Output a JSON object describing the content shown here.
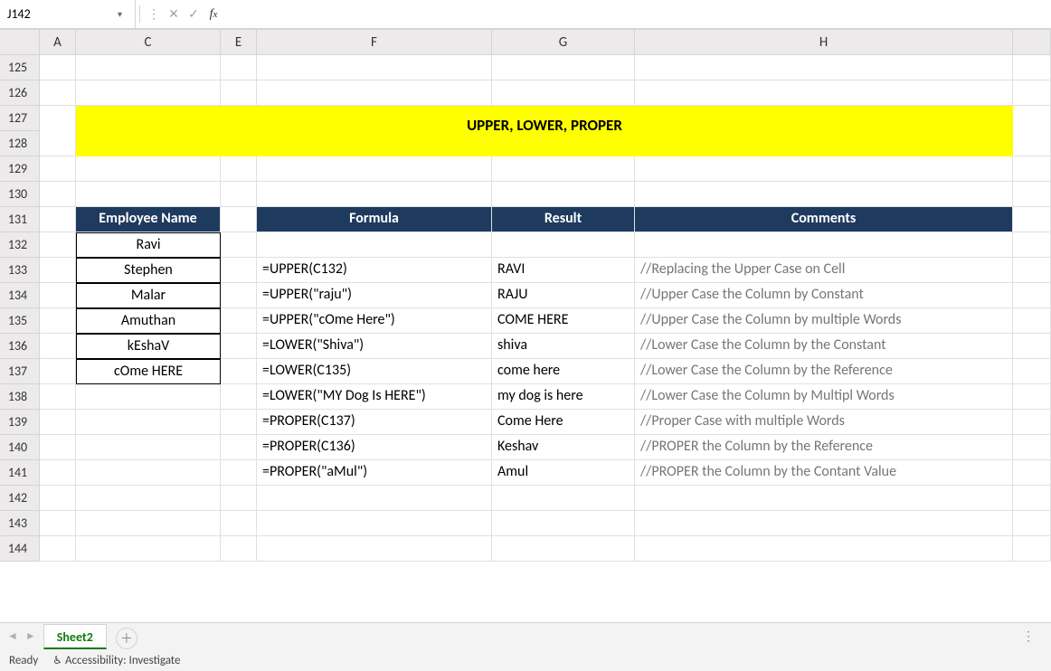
{
  "nameBox": {
    "value": "J142"
  },
  "formulaBar": {
    "value": ""
  },
  "columnHeaders": [
    "A",
    "C",
    "E",
    "F",
    "G",
    "H"
  ],
  "rowHeaders": [
    "125",
    "126",
    "127",
    "128",
    "129",
    "130",
    "131",
    "132",
    "133",
    "134",
    "135",
    "136",
    "137",
    "138",
    "139",
    "140",
    "141",
    "142",
    "143",
    "144"
  ],
  "banner": "UPPER, LOWER, PROPER",
  "headers": {
    "c": "Employee Name",
    "f": "Formula",
    "g": "Result",
    "h": "Comments"
  },
  "employees": [
    "Ravi",
    "Stephen",
    "Malar",
    "Amuthan",
    "kEshaV",
    "cOme HERE"
  ],
  "rows": [
    {
      "f": "=UPPER(C132)",
      "g": "RAVI",
      "h": "//Replacing the Upper Case on Cell"
    },
    {
      "f": "=UPPER(\"raju\")",
      "g": "RAJU",
      "h": "//Upper Case the Column by Constant"
    },
    {
      "f": "=UPPER(\"cOme Here\")",
      "g": "COME HERE",
      "h": "//Upper Case the Column by multiple Words"
    },
    {
      "f": "=LOWER(\"Shiva\")",
      "g": "shiva",
      "h": "//Lower Case the Column by the Constant"
    },
    {
      "f": "=LOWER(C135)",
      "g": "come here",
      "h": "//Lower Case the Column by the Reference"
    },
    {
      "f": "=LOWER(\"MY Dog Is HERE\")",
      "g": "my dog is here",
      "h": "//Lower Case the Column by Multipl Words"
    },
    {
      "f": "=PROPER(C137)",
      "g": "Come Here",
      "h": "//Proper Case with multiple Words"
    },
    {
      "f": "=PROPER(C136)",
      "g": "Keshav",
      "h": "//PROPER the Column by the Reference"
    },
    {
      "f": "=PROPER(\"aMul\")",
      "g": "Amul",
      "h": "//PROPER the Column by the Contant Value"
    }
  ],
  "sheetTab": "Sheet2",
  "status": {
    "ready": "Ready",
    "accessibility": "Accessibility: Investigate"
  }
}
